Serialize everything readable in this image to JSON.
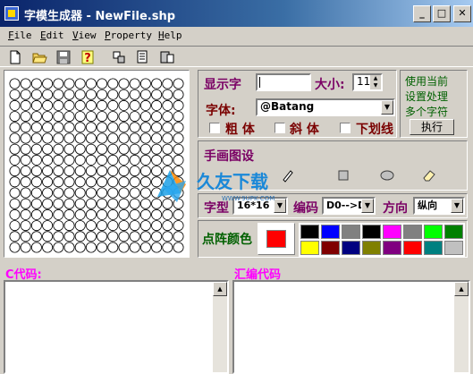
{
  "window": {
    "title": "字模生成器 - NewFile.shp",
    "controls": {
      "minimize": "_",
      "maximize": "□",
      "close": "✕"
    }
  },
  "menu": [
    {
      "label": "File",
      "key": "F"
    },
    {
      "label": "Edit",
      "key": "E"
    },
    {
      "label": "View",
      "key": "V"
    },
    {
      "label": "Property",
      "key": "P"
    },
    {
      "label": "Help",
      "key": "H"
    }
  ],
  "toolbar": {
    "icons": [
      "new-file-icon",
      "open-folder-icon",
      "save-disk-icon",
      "help-question-icon",
      "tool-a-icon",
      "tool-b-icon",
      "tool-c-icon"
    ]
  },
  "settings": {
    "display_char_label": "显示字",
    "display_char_value": "",
    "size_label": "大小:",
    "size_value": "11",
    "font_label": "字体:",
    "font_value": "@Batang",
    "bold_label": "粗 体",
    "italic_label": "斜 体",
    "underline_label": "下划线",
    "note_line1": "使用当前",
    "note_line2": "设置处理",
    "note_line3": "多个字符",
    "execute_label": "执行"
  },
  "draw": {
    "title": "手画图设",
    "tools": [
      "pen-icon",
      "line-icon",
      "rectangle-icon",
      "ellipse-icon",
      "eraser-icon"
    ]
  },
  "format": {
    "type_label": "字型",
    "type_value": "16*16",
    "encoding_label": "编码",
    "encoding_value": "D0-->D",
    "direction_label": "方向",
    "direction_value": "纵向"
  },
  "color": {
    "label": "点阵颜色",
    "current": "#ff0000",
    "palette": [
      "#000000",
      "#0000ff",
      "#808080",
      "#000000",
      "#ff00ff",
      "#808080",
      "#00ff00",
      "#008000",
      "#ffff00",
      "#800000",
      "#000080",
      "#808000",
      "#800080",
      "#ff0000",
      "#008080",
      "#c0c0c0"
    ]
  },
  "code": {
    "c_label": "C代码:",
    "asm_label": "汇编代码"
  },
  "watermark": {
    "text": "久友下载",
    "url": "WWW.9UPK.COM"
  }
}
